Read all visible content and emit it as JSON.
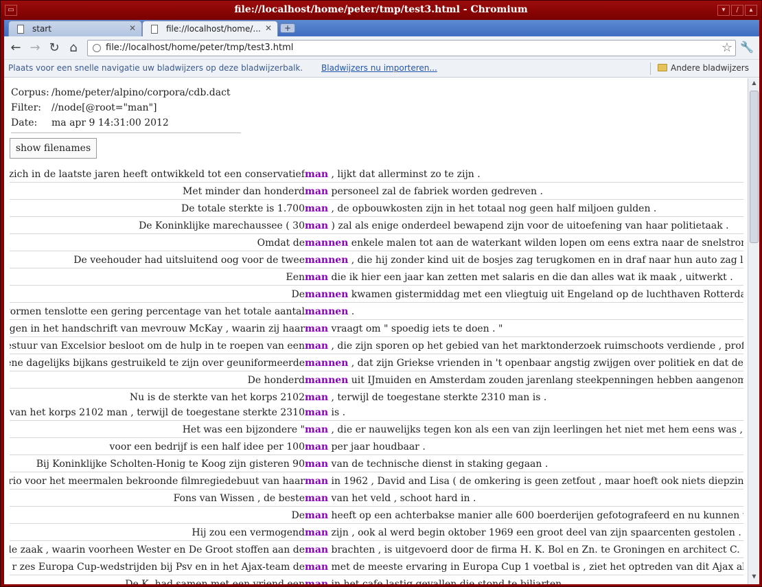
{
  "window": {
    "title": "file://localhost/home/peter/tmp/test3.html - Chromium"
  },
  "tabs": [
    {
      "label": "start",
      "active": false
    },
    {
      "label": "file://localhost/home/...",
      "active": true
    }
  ],
  "toolbar": {
    "back_icon": "back-arrow-icon",
    "forward_icon": "forward-arrow-icon",
    "reload_icon": "reload-icon",
    "home_icon": "home-icon",
    "url": "file://localhost/home/peter/tmp/test3.html"
  },
  "bookmarks": {
    "hint": "Plaats voor een snelle navigatie uw bladwijzers op deze bladwijzerbalk.",
    "import_link": "Bladwijzers nu importeren...",
    "other": "Andere bladwijzers"
  },
  "meta": {
    "corpus_label": "Corpus:",
    "corpus_value": "/home/peter/alpino/corpora/cdb.dact",
    "filter_label": "Filter:",
    "filter_value": "//node[@root=\"man\"]",
    "date_label": "Date:",
    "date_value": "ma apr 9 14:31:00 2012"
  },
  "show_filenames_label": "show filenames",
  "results": [
    {
      "lines": [
        {
          "pre": "zich in de laatste jaren heeft ontwikkeld tot een conservatief ",
          "kw": "man",
          "post": " , lijkt dat allerminst zo te zijn ."
        }
      ]
    },
    {
      "lines": [
        {
          "pre": "Met minder dan honderd ",
          "kw": "man",
          "post": " personeel zal de fabriek worden gedreven ."
        }
      ]
    },
    {
      "lines": [
        {
          "pre": "De totale sterkte is 1.700 ",
          "kw": "man",
          "post": " , de opbouwkosten zijn in het totaal nog geen half miljoen gulden ."
        }
      ]
    },
    {
      "lines": [
        {
          "pre": "De Koninklijke marechaussee ( 30 ",
          "kw": "man",
          "post": " ) zal als enige onderdeel bewapend zijn voor de uitoefening van haar politietaak ."
        }
      ]
    },
    {
      "lines": [
        {
          "pre": "Omdat de ",
          "kw": "mannen",
          "post": " enkele malen tot aan de waterkant wilden lopen om eens extra naar de snelstroming"
        }
      ]
    },
    {
      "lines": [
        {
          "pre": "De veehouder had uitsluitend oog voor de twee ",
          "kw": "mannen",
          "post": " , die hij zonder kind uit de bosjes zag terugkomen en in draf naar hun auto zag lopen"
        }
      ]
    },
    {
      "lines": [
        {
          "pre": "Een ",
          "kw": "man",
          "post": " die ik hier een jaar kan zetten met salaris en die dan alles wat ik maak , uitwerkt ."
        }
      ]
    },
    {
      "lines": [
        {
          "pre": "De ",
          "kw": "mannen",
          "post": " kwamen gistermiddag met een vliegtuig uit Engeland op de luchthaven Rotterdam"
        }
      ]
    },
    {
      "lines": [
        {
          "pre": "vormen tenslotte een gering percentage van het totale aantal ",
          "kw": "mannen",
          "post": " ."
        }
      ]
    },
    {
      "lines": [
        {
          "pre": "gen in het handschrift van mevrouw McKay , waarin zij haar ",
          "kw": "man",
          "post": " vraagt om \" spoedig iets te doen . \""
        }
      ]
    },
    {
      "lines": [
        {
          "pre": "estuur van Excelsior besloot om de hulp in te roepen van een ",
          "kw": "man",
          "post": " , die zijn sporen op het gebied van het marktonderzoek ruimschoots verdiende , prof."
        }
      ]
    },
    {
      "lines": [
        {
          "pre": "ene dagelijks bijkans gestruikeld te zijn over geuniformeerde ",
          "kw": "mannen",
          "post": " , dat zijn Griekse vrienden in 't openbaar angstig zwijgen over politiek en dat de k"
        }
      ]
    },
    {
      "lines": [
        {
          "pre": "De honderd ",
          "kw": "mannen",
          "post": " uit IJmuiden en Amsterdam zouden jarenlang steekpenningen hebben aangenomen"
        }
      ]
    },
    {
      "lines": [
        {
          "pre": "Nu is de sterkte van het korps 2102 ",
          "kw": "man",
          "post": " , terwijl de toegestane sterkte 2310 man is ."
        },
        {
          "pre": "van het korps 2102 man , terwijl de toegestane sterkte 2310 ",
          "kw": "man",
          "post": " is ."
        }
      ]
    },
    {
      "lines": [
        {
          "pre": "Het was een bijzondere \" ",
          "kw": "man",
          "post": " , die er nauwelijks tegen kon als een van zijn leerlingen het niet met hem eens was , m"
        }
      ]
    },
    {
      "lines": [
        {
          "pre": "voor een bedrijf is een half idee per 100 ",
          "kw": "man",
          "post": " per jaar houdbaar ."
        }
      ]
    },
    {
      "lines": [
        {
          "pre": "Bij Koninklijke Scholten-Honig te Koog zijn gisteren 90 ",
          "kw": "man",
          "post": " van de technische dienst in staking gegaan ."
        }
      ]
    },
    {
      "lines": [
        {
          "pre": "rio voor het meermalen bekroonde filmregiedebuut van haar ",
          "kw": "man",
          "post": " in 1962 , David and Lisa ( de omkering is geen zetfout , maar hoeft ook niets diepzinnig"
        }
      ]
    },
    {
      "lines": [
        {
          "pre": "Fons van Wissen , de beste ",
          "kw": "man",
          "post": " van het veld , schoot hard in ."
        }
      ]
    },
    {
      "lines": [
        {
          "pre": "De ",
          "kw": "man",
          "post": " heeft op een achterbakse manier alle 600 boerderijen gefotografeerd en nu kunnen w"
        }
      ]
    },
    {
      "lines": [
        {
          "pre": "Hij zou een vermogend ",
          "kw": "man",
          "post": " zijn , ook al werd begin oktober 1969 een groot deel van zijn spaarcenten gestolen ."
        }
      ]
    },
    {
      "lines": [
        {
          "pre": "le zaak , waarin voorheen Wester en De Groot stoffen aan de ",
          "kw": "man",
          "post": " brachten , is uitgevoerd door de firma H. K. Bol en Zn. te Groningen en architect C. Ri"
        }
      ]
    },
    {
      "lines": [
        {
          "pre": "r zes Europa Cup-wedstrijden bij Psv en in het Ajax-team de ",
          "kw": "man",
          "post": " met de meeste ervaring in Europa Cup 1 voetbal is , ziet het optreden van dit Ajax als"
        }
      ]
    },
    {
      "lines": [
        {
          "pre": "De K. had samen met een vriend een ",
          "kw": "man",
          "post": " in het cafe lastig gevallen die stond te biljarten ."
        }
      ]
    }
  ]
}
